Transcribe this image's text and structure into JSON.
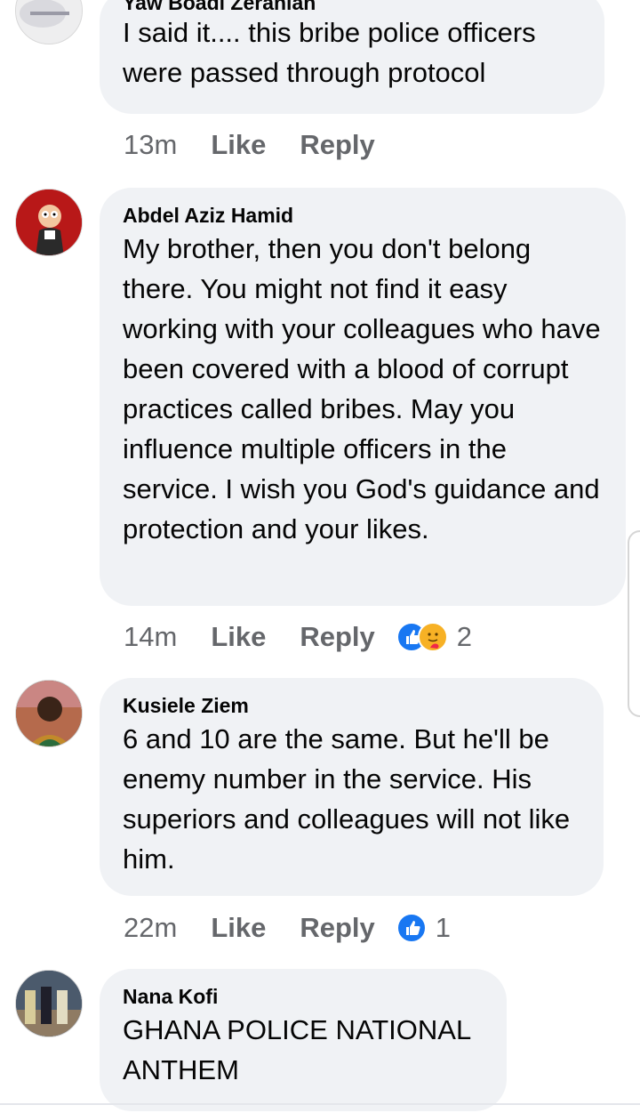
{
  "comments": [
    {
      "author": "Yaw Boadi Zeranian",
      "text": "I said it.... this bribe police officers were passed through protocol",
      "time": "13m",
      "like_label": "Like",
      "reply_label": "Reply"
    },
    {
      "author": "Abdel Aziz Hamid",
      "text": "My brother, then you don't belong there. You might not find it easy working with your colleagues who have been covered with a blood of corrupt practices called bribes. May you influence multiple officers in the service. I wish you God's guidance and protection and your likes.",
      "time": "14m",
      "like_label": "Like",
      "reply_label": "Reply",
      "reaction_count": "2",
      "reactions": [
        "like-icon",
        "care-icon"
      ]
    },
    {
      "author": "Kusiele Ziem",
      "text": "6 and 10 are the same. But he'll be enemy number in the service. His superiors and colleagues will not like him.",
      "time": "22m",
      "like_label": "Like",
      "reply_label": "Reply",
      "reaction_count": "1",
      "reactions": [
        "like-icon"
      ]
    },
    {
      "author": "Nana Kofi",
      "text": "GHANA POLICE NATIONAL ANTHEM"
    }
  ],
  "colors": {
    "bubble": "#f0f2f5",
    "meta_text": "#65676b",
    "like_blue": "#1877f2",
    "care_yellow": "#f7b125"
  }
}
